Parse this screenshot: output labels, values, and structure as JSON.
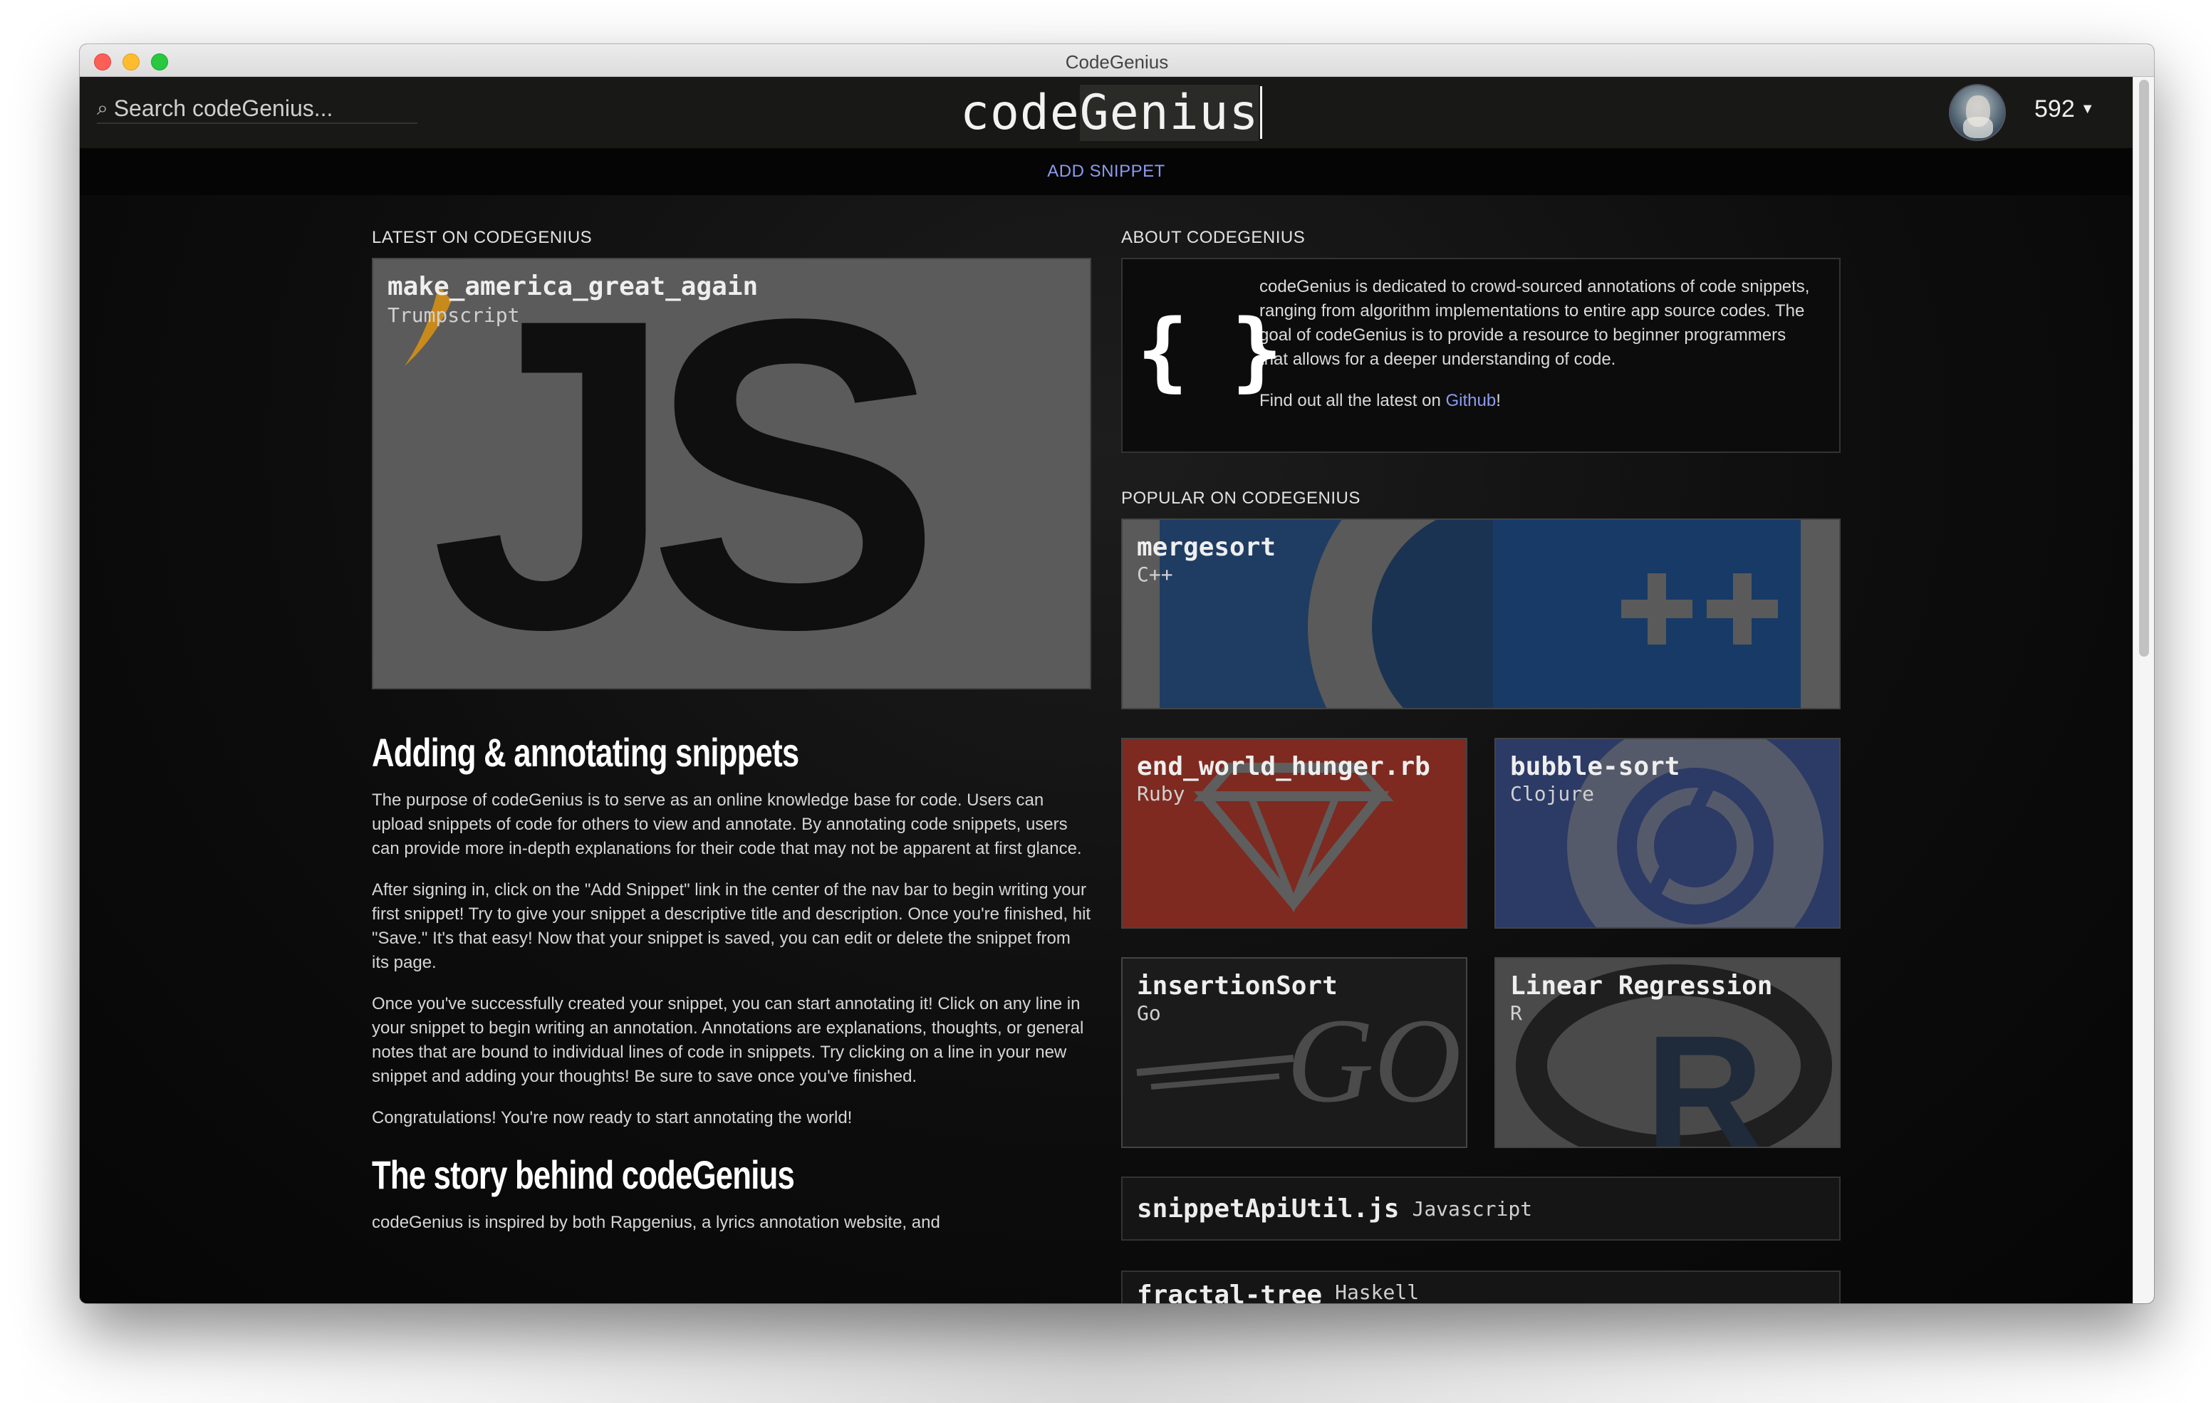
{
  "window": {
    "title": "CodeGenius"
  },
  "nav": {
    "search_placeholder": "Search codeGenius...",
    "logo_pre": "code",
    "logo_hl": "Genius",
    "points": "592",
    "add_snippet": "ADD SNIPPET"
  },
  "latest": {
    "heading": "LATEST ON CODEGENIUS",
    "featured": {
      "title": "make_america_great_again",
      "language": "Trumpscript",
      "logo_text": "JS"
    }
  },
  "article": {
    "h1": "Adding & annotating snippets",
    "paragraphs": [
      "The purpose of codeGenius is to serve as an online knowledge base for code. Users can upload snippets of code for others to view and annotate. By annotating code snippets, users can provide more in-depth explanations for their code that may not be apparent at first glance.",
      "After signing in, click on the \"Add Snippet\" link in the center of the nav bar to begin writing your first snippet! Try to give your snippet a descriptive title and description. Once you're finished, hit \"Save.\" It's that easy! Now that your snippet is saved, you can edit or delete the snippet from its page.",
      "Once you've successfully created your snippet, you can start annotating it! Click on any line in your snippet to begin writing an annotation. Annotations are explanations, thoughts, or general notes that are bound to individual lines of code in snippets. Try clicking on a line in your new snippet and adding your thoughts! Be sure to save once you've finished.",
      "Congratulations! You're now ready to start annotating the world!"
    ],
    "h2": "The story behind codeGenius",
    "p_story": "codeGenius is inspired by both Rapgenius, a lyrics annotation website, and"
  },
  "about": {
    "heading": "ABOUT CODEGENIUS",
    "icon_text": "{ }",
    "text": "codeGenius is dedicated to crowd-sourced annotations of code snippets, ranging from algorithm implementations to entire app source codes. The goal of codeGenius is to provide a resource to beginner programmers that allows for a deeper understanding of code.",
    "find_pre": "Find out all the latest on ",
    "find_link": "Github",
    "find_post": "!"
  },
  "popular": {
    "heading": "POPULAR ON CODEGENIUS",
    "wide": {
      "title": "mergesort",
      "language": "C++"
    },
    "cards": [
      {
        "title": "end_world_hunger.rb",
        "language": "Ruby",
        "bg": "#8a2e22"
      },
      {
        "title": "bubble-sort",
        "language": "Clojure",
        "bg": "#2c3a66"
      },
      {
        "title": "insertionSort",
        "language": "Go",
        "bg": "#1a1a1a",
        "logo_text": "GO"
      },
      {
        "title": "Linear Regression",
        "language": "R",
        "bg": "#444444",
        "logo_text": "R"
      }
    ],
    "list": [
      {
        "title": "snippetApiUtil.js",
        "language": "Javascript"
      },
      {
        "title": "fractal-tree",
        "language": "Haskell"
      }
    ]
  },
  "colors": {
    "accent_link": "#8c9bf0",
    "nav_bg": "#181816",
    "subnav_bg": "#050505"
  }
}
